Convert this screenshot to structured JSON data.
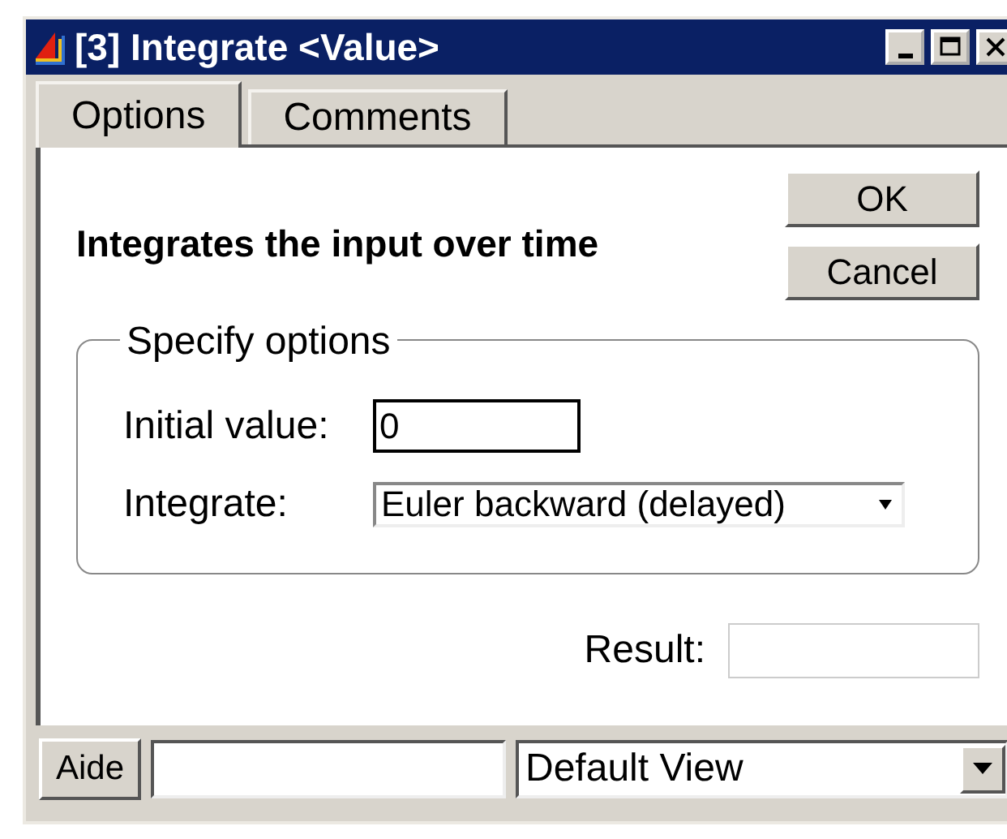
{
  "window": {
    "title": "[3] Integrate <Value>"
  },
  "tabs": [
    {
      "label": "Options",
      "selected": true
    },
    {
      "label": "Comments",
      "selected": false
    }
  ],
  "description": "Integrates the input over time",
  "buttons": [
    "OK",
    "Cancel"
  ],
  "options_group": {
    "title": "Specify options",
    "initial_value": {
      "label": "Initial value:",
      "value": "0"
    },
    "integrate": {
      "label": "Integrate:",
      "value": "Euler backward (delayed)"
    }
  },
  "result": {
    "label": "Result:"
  },
  "bottom_bar": {
    "help_button": "Aide",
    "view_select": "Default View"
  }
}
